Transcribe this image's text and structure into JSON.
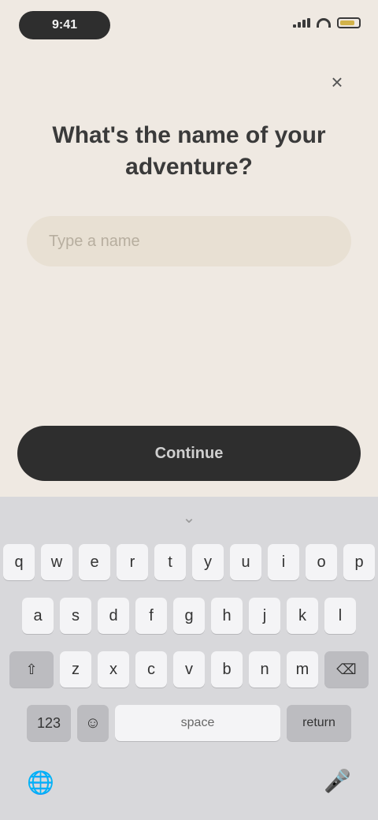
{
  "status_bar": {
    "time": "9:41"
  },
  "close_icon": "×",
  "title": "What's the name of your adventure?",
  "input": {
    "value": "",
    "placeholder": "Type a name"
  },
  "continue_label": "Continue",
  "keyboard": {
    "rows": [
      [
        "q",
        "w",
        "e",
        "r",
        "t",
        "y",
        "u",
        "i",
        "o",
        "p"
      ],
      [
        "a",
        "s",
        "d",
        "f",
        "g",
        "h",
        "j",
        "k",
        "l"
      ],
      [
        "⇧",
        "z",
        "x",
        "c",
        "v",
        "b",
        "n",
        "m",
        "⌫"
      ]
    ],
    "mode_key": "123",
    "emoji_key": "☺",
    "space_label": "space",
    "return_label": "return"
  },
  "icons": {
    "globe": "🌐",
    "mic": "🎤",
    "chevron": "⌄"
  }
}
